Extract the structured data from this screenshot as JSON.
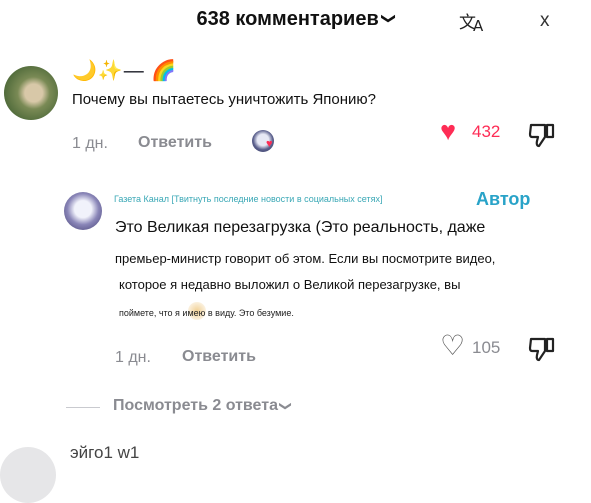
{
  "header": {
    "title": "638 комментариев",
    "translate_icon": "translate-icon",
    "close_symbol": "x"
  },
  "comments": [
    {
      "username": "🌙✨— 🌈",
      "text": "Почему вы пытаетесь уничтожить Японию?",
      "time": "1 дн.",
      "reply_label": "Ответить",
      "like_count": "432",
      "liked": true,
      "liked_by_creator": true
    },
    {
      "username": "Газета Канал [Твитнуть последние новости в социальных сетях]",
      "badge": "Автор",
      "text_lines": [
        "Это Великая перезагрузка (Это реальность, даже",
        "премьер-министр говорит об этом. Если вы посмотрите видео,",
        "которое я недавно выложил о Великой перезагрузке, вы",
        "поймете, что я имею в виду. Это безумие."
      ],
      "time": "1 дн.",
      "reply_label": "Ответить",
      "like_count": "105",
      "liked": false
    }
  ],
  "view_replies": {
    "label": "Посмотреть 2 ответа"
  },
  "next_comment": {
    "username": "эйго1 w1"
  },
  "colors": {
    "accent_red": "#fe2c55",
    "author_blue": "#29a3c8",
    "muted": "#8a8b91"
  }
}
